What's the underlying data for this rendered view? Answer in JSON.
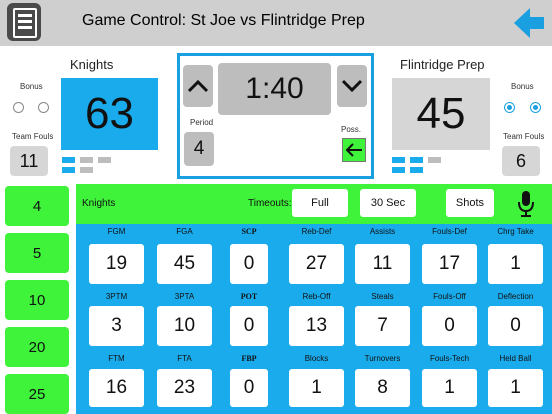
{
  "header": {
    "title": "Game Control: St Joe vs Flintridge Prep",
    "menu_icon": "menu-icon",
    "back_icon": "back-arrow-icon"
  },
  "home": {
    "name": "Knights",
    "score": "63",
    "bonus_label": "Bonus",
    "team_fouls_label": "Team Fouls",
    "team_fouls": "11",
    "score_color": "#1aabec"
  },
  "away": {
    "name": "Flintridge Prep",
    "score": "45",
    "bonus_label": "Bonus",
    "team_fouls_label": "Team Fouls",
    "team_fouls": "6",
    "score_color": "#d6d6d6"
  },
  "clock": {
    "time": "1:40",
    "period_label": "Period",
    "period": "4",
    "poss_label": "Poss."
  },
  "side_buttons": [
    "4",
    "5",
    "10",
    "20",
    "25"
  ],
  "stats_bar": {
    "team": "Knights",
    "timeouts_label": "Timeouts:",
    "full_label": "Full",
    "sec30_label": "30 Sec",
    "shots_label": "Shots",
    "mic_icon": "microphone-icon"
  },
  "stats": [
    [
      {
        "label": "FGM",
        "value": "19"
      },
      {
        "label": "FGA",
        "value": "45"
      },
      {
        "label": "SCP",
        "value": "0"
      },
      {
        "label": "Reb-Def",
        "value": "27"
      },
      {
        "label": "Assists",
        "value": "11"
      },
      {
        "label": "Fouls-Def",
        "value": "17"
      },
      {
        "label": "Chrg Take",
        "value": "1"
      }
    ],
    [
      {
        "label": "3PTM",
        "value": "3"
      },
      {
        "label": "3PTA",
        "value": "10"
      },
      {
        "label": "POT",
        "value": "0"
      },
      {
        "label": "Reb-Off",
        "value": "13"
      },
      {
        "label": "Steals",
        "value": "7"
      },
      {
        "label": "Fouls-Off",
        "value": "0"
      },
      {
        "label": "Deflection",
        "value": "0"
      }
    ],
    [
      {
        "label": "FTM",
        "value": "16"
      },
      {
        "label": "FTA",
        "value": "23"
      },
      {
        "label": "FBP",
        "value": "0"
      },
      {
        "label": "Blocks",
        "value": "1"
      },
      {
        "label": "Turnovers",
        "value": "8"
      },
      {
        "label": "Fouls-Tech",
        "value": "1"
      },
      {
        "label": "Held Ball",
        "value": "1"
      }
    ]
  ],
  "colors": {
    "accent_blue": "#1aabec",
    "accent_green": "#3ff23a",
    "header_gray": "#cfcfcf"
  }
}
